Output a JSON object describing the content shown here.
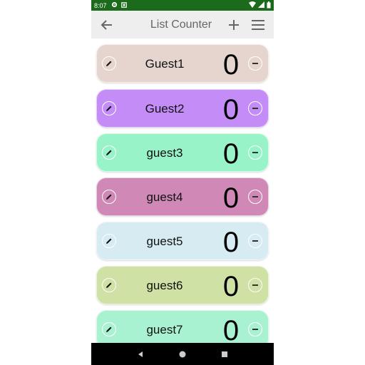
{
  "status_bar": {
    "time": "8:07",
    "icons": [
      "settings-icon",
      "notification-icon",
      "wifi-icon",
      "signal-icon",
      "battery-icon"
    ]
  },
  "app_bar": {
    "title": "List Counter",
    "back_icon": "arrow-left-icon",
    "add_icon": "plus-icon",
    "menu_icon": "menu-icon"
  },
  "items": [
    {
      "name": "Guest1",
      "count": "0",
      "color": "#e6d5cf"
    },
    {
      "name": "Guest2",
      "count": "0",
      "color": "#c48cf7"
    },
    {
      "name": "guest3",
      "count": "0",
      "color": "#98f3c9"
    },
    {
      "name": "guest4",
      "count": "0",
      "color": "#d088b6"
    },
    {
      "name": "guest5",
      "count": "0",
      "color": "#d6ebf2"
    },
    {
      "name": "guest6",
      "count": "0",
      "color": "#cfe1a5"
    },
    {
      "name": "guest7",
      "count": "0",
      "color": "#a8f2d1"
    }
  ],
  "nav_bar": {
    "back": "back-triangle-icon",
    "home": "home-circle-icon",
    "recents": "recents-square-icon"
  }
}
